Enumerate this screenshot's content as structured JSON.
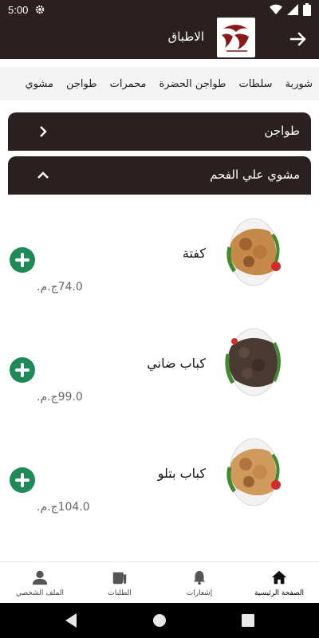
{
  "status_bar": {
    "time": "5:00"
  },
  "header": {
    "title": "الاطباق"
  },
  "tabs": [
    "شوربة",
    "سلطات",
    "طواجن الحضرة",
    "محمرات",
    "طواجن",
    "مشوي"
  ],
  "sections": [
    {
      "label": "طواجن",
      "expanded": false
    },
    {
      "label": "مشوي علي الفحم",
      "expanded": true
    }
  ],
  "dishes": [
    {
      "name": "كفتة",
      "price": "74.0ج.م."
    },
    {
      "name": "كباب ضاني",
      "price": "99.0ج.م."
    },
    {
      "name": "كباب بتلو",
      "price": "104.0ج.م."
    }
  ],
  "bottom_nav": [
    {
      "label": "الصفحة الرئيسية",
      "icon": "home-icon",
      "active": true
    },
    {
      "label": "إشعارات",
      "icon": "bell-icon",
      "active": false
    },
    {
      "label": "الطلبات",
      "icon": "orders-icon",
      "active": false
    },
    {
      "label": "الملف الشخصي",
      "icon": "profile-icon",
      "active": false
    }
  ],
  "colors": {
    "dark": "#2a2020",
    "accent_green": "#1f8a57",
    "tab_bg": "#f3f3f3"
  }
}
